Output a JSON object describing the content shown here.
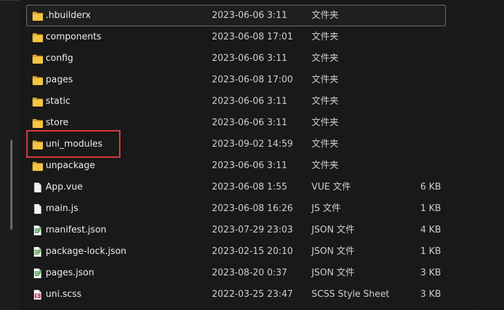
{
  "files": [
    {
      "name": ".hbuilderx",
      "date": "2023-06-06 3:11",
      "type": "文件夹",
      "size": "",
      "icon": "folder-icon",
      "focused": true
    },
    {
      "name": "components",
      "date": "2023-06-08 17:01",
      "type": "文件夹",
      "size": "",
      "icon": "folder-icon"
    },
    {
      "name": "config",
      "date": "2023-06-06 3:11",
      "type": "文件夹",
      "size": "",
      "icon": "folder-icon"
    },
    {
      "name": "pages",
      "date": "2023-06-08 17:00",
      "type": "文件夹",
      "size": "",
      "icon": "folder-icon"
    },
    {
      "name": "static",
      "date": "2023-06-06 3:11",
      "type": "文件夹",
      "size": "",
      "icon": "folder-icon"
    },
    {
      "name": "store",
      "date": "2023-06-06 3:11",
      "type": "文件夹",
      "size": "",
      "icon": "folder-icon"
    },
    {
      "name": "uni_modules",
      "date": "2023-09-02 14:59",
      "type": "文件夹",
      "size": "",
      "icon": "folder-icon",
      "highlighted": true
    },
    {
      "name": "unpackage",
      "date": "2023-06-06 3:11",
      "type": "文件夹",
      "size": "",
      "icon": "folder-icon"
    },
    {
      "name": "App.vue",
      "date": "2023-06-08 1:55",
      "type": "VUE 文件",
      "size": "6 KB",
      "icon": "file-icon"
    },
    {
      "name": "main.js",
      "date": "2023-06-08 16:26",
      "type": "JS 文件",
      "size": "1 KB",
      "icon": "file-icon"
    },
    {
      "name": "manifest.json",
      "date": "2023-07-29 23:03",
      "type": "JSON 文件",
      "size": "4 KB",
      "icon": "json-file-icon"
    },
    {
      "name": "package-lock.json",
      "date": "2023-02-15 20:10",
      "type": "JSON 文件",
      "size": "1 KB",
      "icon": "json-file-icon"
    },
    {
      "name": "pages.json",
      "date": "2023-08-20 0:37",
      "type": "JSON 文件",
      "size": "3 KB",
      "icon": "json-file-icon"
    },
    {
      "name": "uni.scss",
      "date": "2022-03-25 23:47",
      "type": "SCSS Style Sheet",
      "size": "3 KB",
      "icon": "scss-file-icon"
    }
  ],
  "colors": {
    "background": "#191919",
    "folder": "#f4c544",
    "highlight": "#e2383a"
  }
}
